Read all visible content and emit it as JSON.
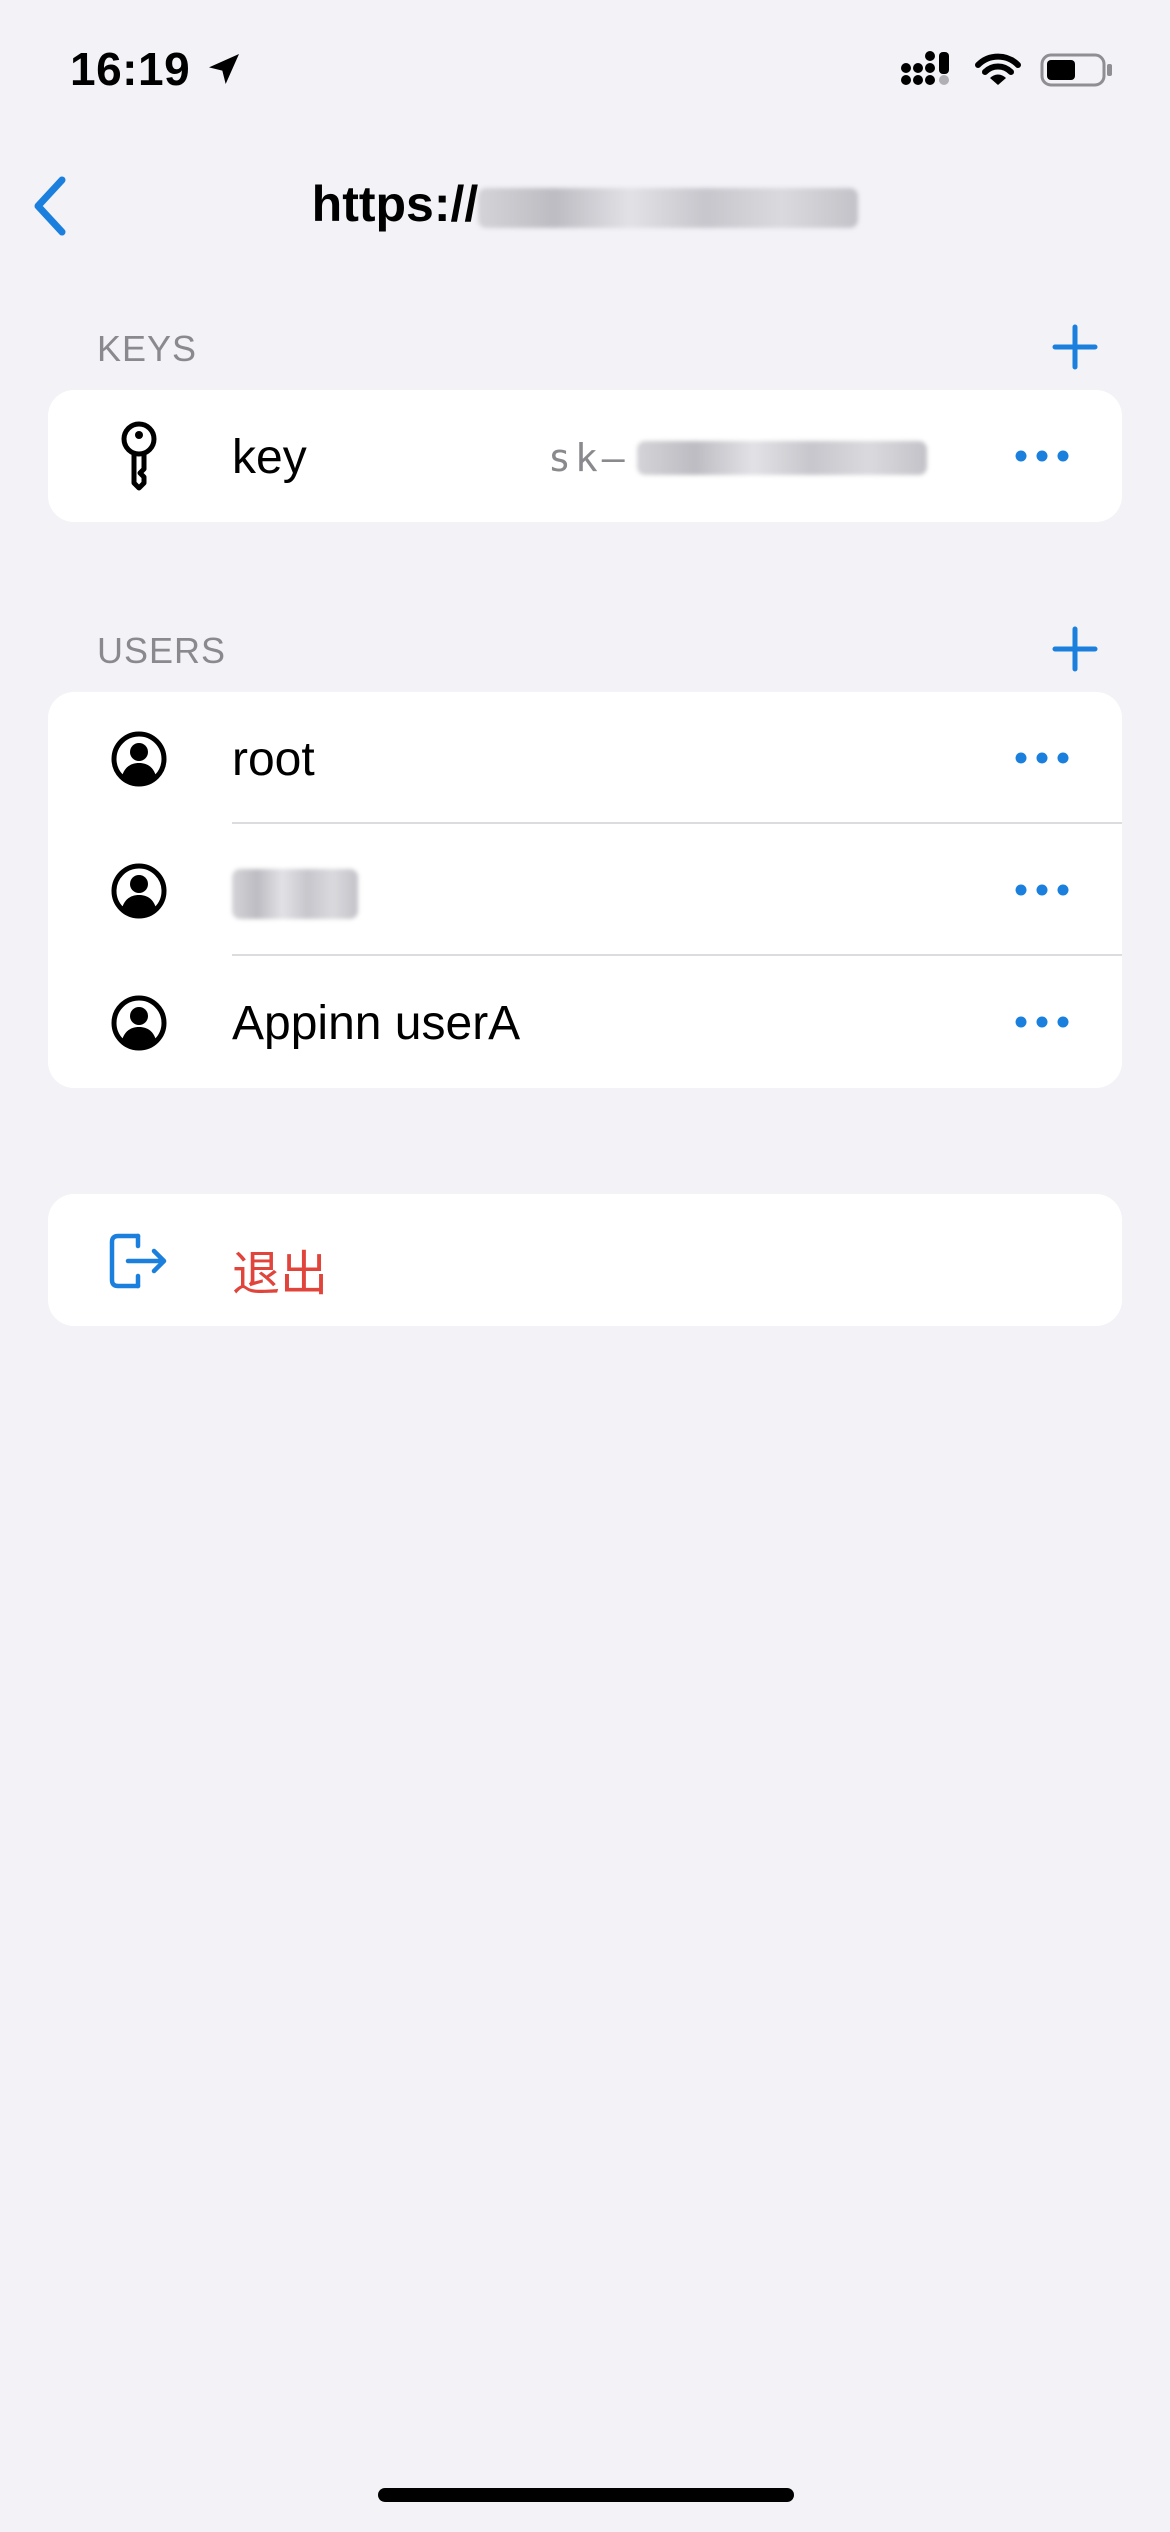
{
  "status_bar": {
    "time": "16:19",
    "icons": [
      "location-arrow-icon",
      "cellular-signal-icon",
      "wifi-icon",
      "battery-icon"
    ],
    "battery_level": 0.5
  },
  "nav": {
    "back_icon": "chevron-left-icon",
    "title_prefix": "https://"
  },
  "keys_section": {
    "header": "KEYS",
    "add_icon": "plus-icon",
    "items": [
      {
        "icon": "key-icon",
        "label": "key",
        "value_prefix": "sk–",
        "more_icon": "ellipsis-icon"
      }
    ]
  },
  "users_section": {
    "header": "USERS",
    "add_icon": "plus-icon",
    "items": [
      {
        "icon": "person-circle-icon",
        "label": "root",
        "more_icon": "ellipsis-icon"
      },
      {
        "icon": "person-circle-icon",
        "label": "",
        "more_icon": "ellipsis-icon"
      },
      {
        "icon": "person-circle-icon",
        "label": "Appinn userA",
        "more_icon": "ellipsis-icon"
      }
    ]
  },
  "logout": {
    "icon": "logout-icon",
    "label": "退出"
  },
  "colors": {
    "accent": "#1a7fdd",
    "destructive": "#e0443b",
    "background": "#f2f2f7",
    "card": "#ffffff",
    "secondary_text": "#8a8a8e"
  }
}
